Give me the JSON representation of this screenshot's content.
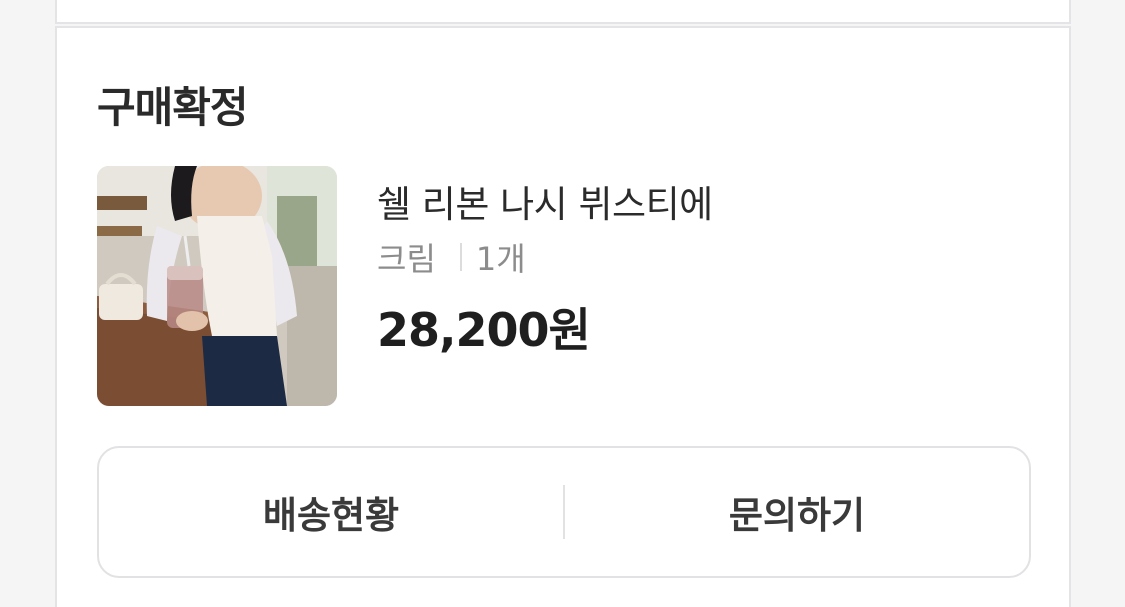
{
  "order": {
    "status": "구매확정",
    "product": {
      "name": "쉘 리본 나시 뷔스티에",
      "option": "크림",
      "quantity": "1개",
      "price": "28,200원",
      "image_icon": "product-photo"
    },
    "actions": {
      "delivery_status_label": "배송현황",
      "inquiry_label": "문의하기"
    }
  },
  "colors": {
    "background": "#f5f5f6",
    "card": "#ffffff",
    "border": "#e4e4e6",
    "text_primary": "#222222",
    "text_secondary": "#8c8c8c"
  }
}
